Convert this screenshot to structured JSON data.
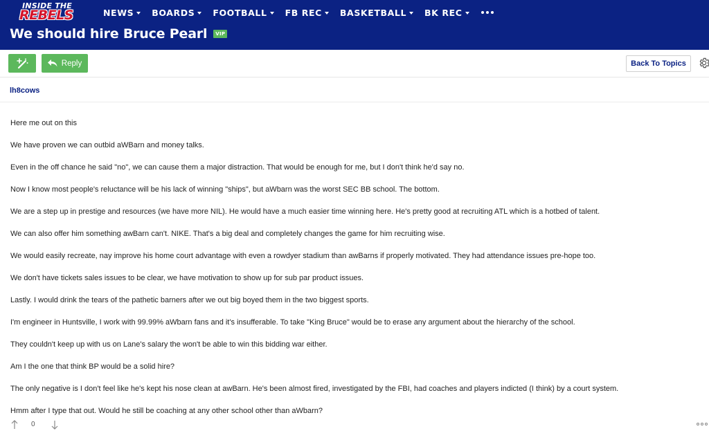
{
  "site": {
    "logo_line1": "INSIDE THE",
    "logo_line2": "REBELS"
  },
  "nav": {
    "items": [
      {
        "label": "NEWS"
      },
      {
        "label": "BOARDS"
      },
      {
        "label": "FOOTBALL"
      },
      {
        "label": "FB REC"
      },
      {
        "label": "BASKETBALL"
      },
      {
        "label": "BK REC"
      }
    ],
    "more_icon": "ellipsis-icon"
  },
  "thread": {
    "title": "We should hire Bruce Pearl",
    "badge": "VIP"
  },
  "toolbar": {
    "new_post_icon": "magic-wand-icon",
    "reply_label": "Reply",
    "back_label": "Back To Topics",
    "settings_icon": "gear-icon"
  },
  "post": {
    "author": "lh8cows",
    "paragraphs": [
      "Here me out on this",
      "We have proven we can outbid aWBarn and money talks.",
      "Even in the off chance he said \"no\", we can cause them a major distraction. That would be enough for me, but I don't think he'd say no.",
      "Now I know most people's reluctance will be his lack of winning \"ships\", but aWbarn was the worst SEC BB school. The bottom.",
      "We are a step up in prestige and resources (we have more NIL). He would have a much easier time winning here. He's pretty good at recruiting ATL which is a hotbed of talent.",
      "We can also offer him something awBarn can't. NIKE. That's a big deal and completely changes the game for him recruiting wise.",
      "We would easily recreate, nay improve his home court advantage with even a rowdyer stadium than awBarns if properly motivated. They had attendance issues pre-hope too.",
      "We don't have tickets sales issues to be clear, we have motivation to show up for sub par product issues.",
      "Lastly. I would drink the tears of the pathetic barners after we out big boyed them in the two biggest sports.",
      "I'm engineer in Huntsville, I work with 99.99% aWbarn fans and it's insufferable. To take \"King Bruce\" would be to erase any argument about the hierarchy of the school.",
      "They couldn't keep up with us on Lane's salary the won't be able to win this bidding war either.",
      "Am I the one that think BP would be a solid hire?",
      "The only negative is I don't feel like he's kept his nose clean at awBarn. He's been almost fired, investigated by the FBI, had coaches and players indicted (I think) by a court system.",
      "Hmm after I type that out. Would he still be coaching at any other school other than aWbarn?"
    ],
    "vote_count": "0",
    "upvote_icon": "arrow-up-icon",
    "downvote_icon": "arrow-down-icon",
    "menu_icon": "more-options-icon"
  }
}
